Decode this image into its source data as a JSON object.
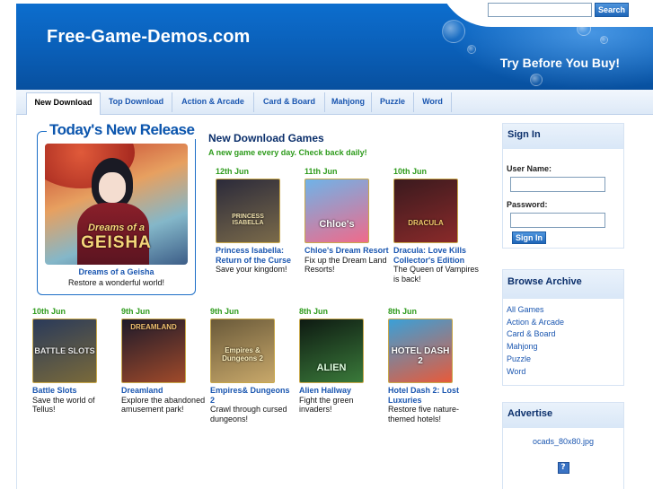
{
  "header": {
    "site_title": "Free-Game-Demos.com",
    "tagline": "Try Before You Buy!",
    "search_button": "Search",
    "search_value": ""
  },
  "nav": {
    "tabs": [
      {
        "label": "New Download",
        "active": true
      },
      {
        "label": "Top Download",
        "active": false
      },
      {
        "label": "Action & Arcade",
        "active": false
      },
      {
        "label": "Card & Board",
        "active": false
      },
      {
        "label": "Mahjong",
        "active": false
      },
      {
        "label": "Puzzle",
        "active": false
      },
      {
        "label": "Word",
        "active": false
      }
    ]
  },
  "featured": {
    "heading": "Today's New Release",
    "art_line1": "Dreams of a",
    "art_line2": "GEISHA",
    "name": "Dreams of a Geisha",
    "description": "Restore a wonderful world!"
  },
  "new_downloads": {
    "heading": "New Download Games",
    "subheading": "A new game every day. Check back daily!",
    "games": [
      {
        "date": "12th Jun",
        "name": "Princess Isabella: Return of the Curse",
        "description": "Save your kingdom!",
        "art": "PRINCESS ISABELLA",
        "color1": "#2b2a3a",
        "color2": "#7a6a4a"
      },
      {
        "date": "11th Jun",
        "name": "Chloe's Dream Resort",
        "description": "Fix up the Dream Land Resorts!",
        "art": "Chloe's",
        "color1": "#6fb3e8",
        "color2": "#f06a8a"
      },
      {
        "date": "10th Jun",
        "name": "Dracula: Love Kills Collector's Edition",
        "description": "The Queen of Vampires is back!",
        "art": "DRACULA",
        "color1": "#3a1a1e",
        "color2": "#8a2a2a"
      },
      {
        "date": "10th Jun",
        "name": "Battle Slots",
        "description": "Save the world of Tellus!",
        "art": "BATTLE SLOTS",
        "color1": "#2a3a5a",
        "color2": "#7a6a3a"
      },
      {
        "date": "9th Jun",
        "name": "Dreamland",
        "description": "Explore the abandoned amusement park!",
        "art": "DREAMLAND",
        "color1": "#1e1a2a",
        "color2": "#a04a2a"
      },
      {
        "date": "9th Jun",
        "name": "Empires& Dungeons 2",
        "description": "Crawl through cursed dungeons!",
        "art": "Empires & Dungeons 2",
        "color1": "#6a5a3a",
        "color2": "#c8a86a"
      },
      {
        "date": "8th Jun",
        "name": "Alien Hallway",
        "description": "Fight the green invaders!",
        "art": "ALIEN",
        "color1": "#0e1a12",
        "color2": "#3a7a3a"
      },
      {
        "date": "8th Jun",
        "name": "Hotel Dash 2: Lost Luxuries",
        "description": "Restore five nature-themed hotels!",
        "art": "HOTEL DASH 2",
        "color1": "#3aa0d8",
        "color2": "#e85a3a"
      }
    ]
  },
  "sidebar": {
    "signin": {
      "heading": "Sign In",
      "username_label": "User Name:",
      "password_label": "Password:",
      "button": "Sign In"
    },
    "archive": {
      "heading": "Browse Archive",
      "links": [
        "All Games",
        "Action & Arcade",
        "Card & Board",
        "Mahjong",
        "Puzzle",
        "Word"
      ]
    },
    "advertise": {
      "heading": "Advertise",
      "ad_text": "ocads_80x80.jpg",
      "ad_icon": "?"
    }
  },
  "colors": {
    "brand_blue": "#0a5fb8",
    "link_blue": "#1a56b0",
    "date_green": "#2e9b1c"
  }
}
